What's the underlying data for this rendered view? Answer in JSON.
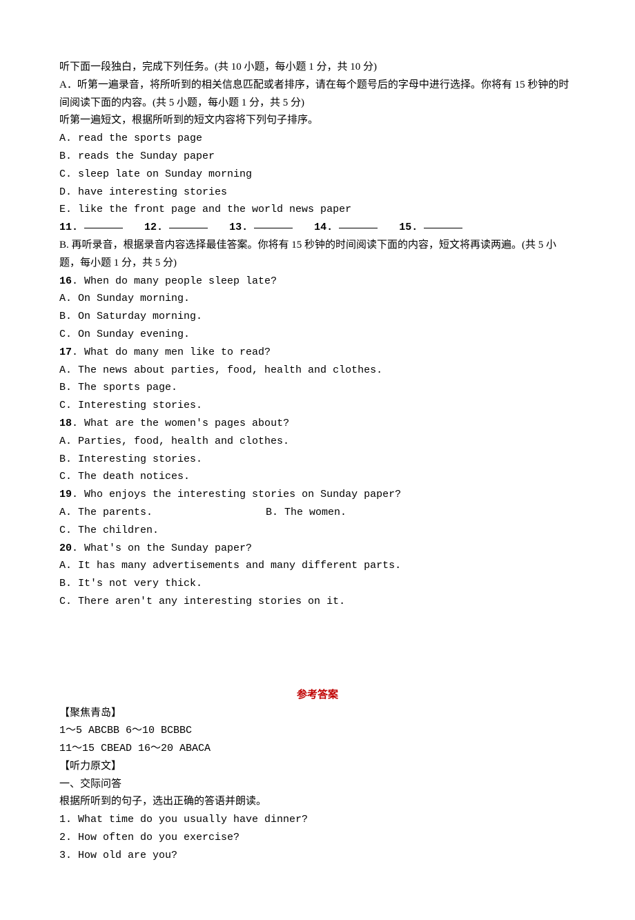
{
  "intro": {
    "line1": "听下面一段独白，完成下列任务。(共 10 小题，每小题 1 分，共 10 分)",
    "line2": "A．听第一遍录音，将所听到的相关信息匹配或者排序，请在每个题号后的字母中进行选择。你将有 15 秒钟的时间阅读下面的内容。(共 5 小题，每小题 1 分，共 5 分)",
    "line3": "听第一遍短文，根据所听到的短文内容将下列句子排序。"
  },
  "ordering": {
    "a": "A. read the sports page",
    "b": "B. reads the Sunday paper",
    "c": "C. sleep late on Sunday morning",
    "d": "D. have interesting stories",
    "e": "E. like the front page and the world news paper"
  },
  "fill": {
    "q11": "11.",
    "q12": "12.",
    "q13": "13.",
    "q14": "14.",
    "q15": "15."
  },
  "partB": "B. 再听录音，根据录音内容选择最佳答案。你将有 15 秒钟的时间阅读下面的内容，短文将再读两遍。(共 5 小题，每小题 1 分，共 5 分)",
  "q16": {
    "q": "16. When do many people sleep late?",
    "a": "A. On Sunday morning.",
    "b": "B. On Saturday morning.",
    "c": "C. On Sunday evening."
  },
  "q17": {
    "q": "17. What do many men like to read?",
    "a": "A. The news about parties, food, health and clothes.",
    "b": "B. The sports page.",
    "c": "C. Interesting stories."
  },
  "q18": {
    "q": "18. What are the women's pages about?",
    "a": "A. Parties, food, health and clothes.",
    "b": "B. Interesting stories.",
    "c": "C. The death notices."
  },
  "q19": {
    "q": "19. Who enjoys the interesting stories on Sunday paper?",
    "a": "A. The parents.",
    "b": "B. The women.",
    "c": "C. The children."
  },
  "q20": {
    "q": "20. What's on the Sunday paper?",
    "a": "A. It has many advertisements and many different parts.",
    "b": "B. It's not very thick.",
    "c": "C. There aren't any interesting stories on it."
  },
  "answers": {
    "title": "参考答案",
    "focus": "【聚焦青岛】",
    "row1": "1～5  ABCBB  6～10 BCBBC",
    "row2": "11～15 CBEAD  16～20 ABACA",
    "listening_heading": "【听力原文】",
    "section1_heading": "一、交际问答",
    "section1_instr": "根据所听到的句子，选出正确的答语并朗读。",
    "l1": "1. What time do you usually have dinner?",
    "l2": "2. How often do you exercise?",
    "l3": "3. How old are you?"
  }
}
